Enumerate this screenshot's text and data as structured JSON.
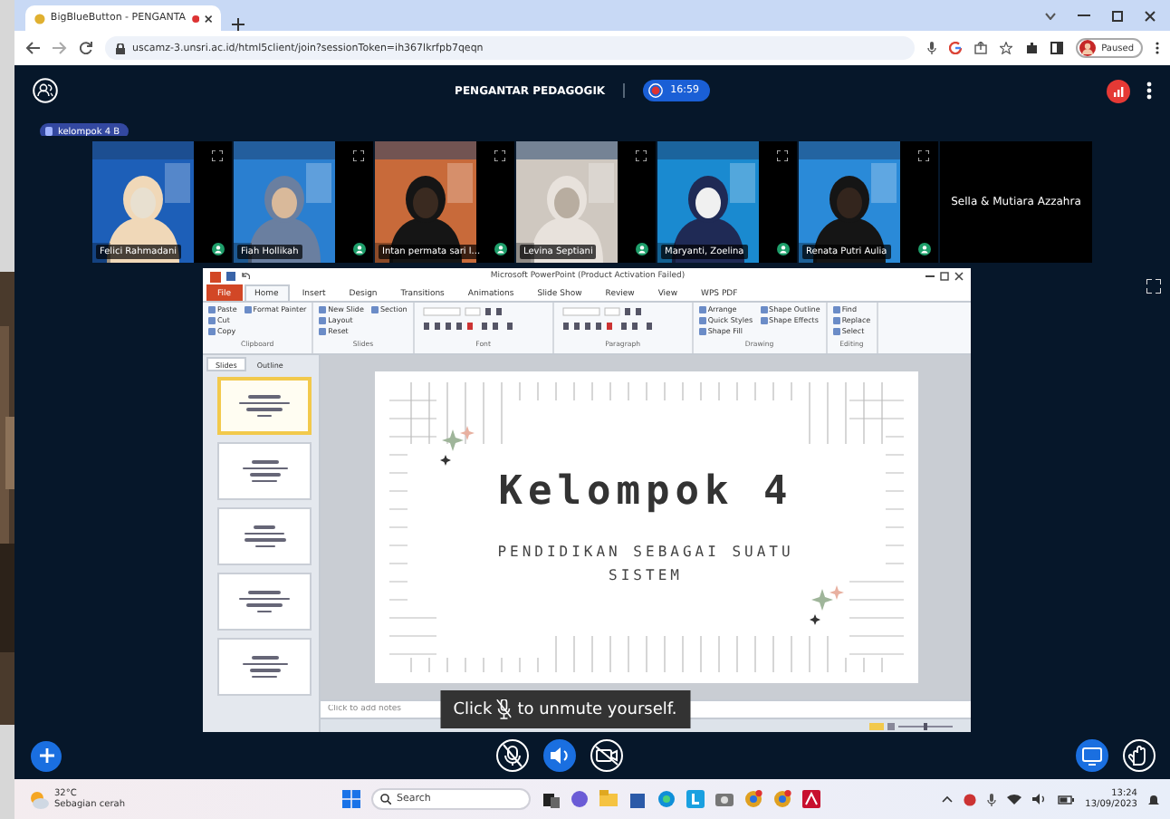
{
  "browser": {
    "tab_title": "BigBlueButton - PENGANTA",
    "url": "uscamz-3.unsri.ac.id/html5client/join?sessionToken=ih367lkrfpb7qeqn",
    "profile": "Paused"
  },
  "meeting": {
    "title": "PENGANTAR PEDAGOGIK",
    "recording": true,
    "timer": "16:59",
    "breakout": "kelompok 4 B"
  },
  "videos": [
    {
      "name": "Felici Rahmadani",
      "kind": "camera"
    },
    {
      "name": "Fiah Hollikah",
      "kind": "camera"
    },
    {
      "name": "Intan permata sari l...",
      "kind": "camera"
    },
    {
      "name": "Levina Septiani",
      "kind": "camera"
    },
    {
      "name": "Maryanti, Zoelina",
      "kind": "camera"
    },
    {
      "name": "Renata Putri Aulia",
      "kind": "camera"
    },
    {
      "name": "Sella & Mutiara Azzahra",
      "kind": "name"
    }
  ],
  "presentation": {
    "window_title": "Microsoft PowerPoint (Product Activation Failed)",
    "ribbon_tabs": [
      {
        "label": "File",
        "kind": "file",
        "selected": false
      },
      {
        "label": "Home",
        "kind": "tab",
        "selected": true
      },
      {
        "label": "Insert",
        "kind": "tab",
        "selected": false
      },
      {
        "label": "Design",
        "kind": "tab",
        "selected": false
      },
      {
        "label": "Transitions",
        "kind": "tab",
        "selected": false
      },
      {
        "label": "Animations",
        "kind": "tab",
        "selected": false
      },
      {
        "label": "Slide Show",
        "kind": "tab",
        "selected": false
      },
      {
        "label": "Review",
        "kind": "tab",
        "selected": false
      },
      {
        "label": "View",
        "kind": "tab",
        "selected": false
      },
      {
        "label": "WPS PDF",
        "kind": "tab",
        "selected": false
      }
    ],
    "ribbon_groups": [
      {
        "label": "Clipboard",
        "items": [
          "Paste",
          "Cut",
          "Copy",
          "Format Painter"
        ]
      },
      {
        "label": "Slides",
        "items": [
          "New Slide",
          "Layout",
          "Reset",
          "Section"
        ]
      },
      {
        "label": "Font"
      },
      {
        "label": "Paragraph"
      },
      {
        "label": "Drawing",
        "items": [
          "Arrange",
          "Quick Styles",
          "Shape Fill",
          "Shape Outline",
          "Shape Effects"
        ]
      },
      {
        "label": "Editing",
        "items": [
          "Find",
          "Replace",
          "Select"
        ]
      }
    ],
    "panel_tabs": [
      {
        "label": "Slides",
        "selected": true
      },
      {
        "label": "Outline",
        "selected": false
      }
    ],
    "thumbnails": [
      {
        "selected": true
      },
      {
        "selected": false
      },
      {
        "selected": false
      },
      {
        "selected": false
      },
      {
        "selected": false
      }
    ],
    "slide": {
      "title": "Kelompok 4",
      "subtitle": "PENDIDIKAN SEBAGAI SUATU SISTEM"
    },
    "notes": {
      "placeholder": "Click to add notes"
    }
  },
  "tooltip": {
    "before": "Click",
    "after": "to unmute yourself."
  },
  "controls": [
    {
      "kind": "microphone",
      "active": false
    },
    {
      "kind": "audio",
      "active": true
    },
    {
      "kind": "camera",
      "active": false
    }
  ],
  "right_controls": [
    {
      "kind": "screenshare",
      "active": true
    },
    {
      "kind": "hand",
      "active": false
    }
  ],
  "taskbar": {
    "temperature": "32°C",
    "weather": "Sebagian cerah",
    "search": {
      "placeholder": "Search"
    },
    "time": "13:24",
    "date": "13/09/2023"
  }
}
